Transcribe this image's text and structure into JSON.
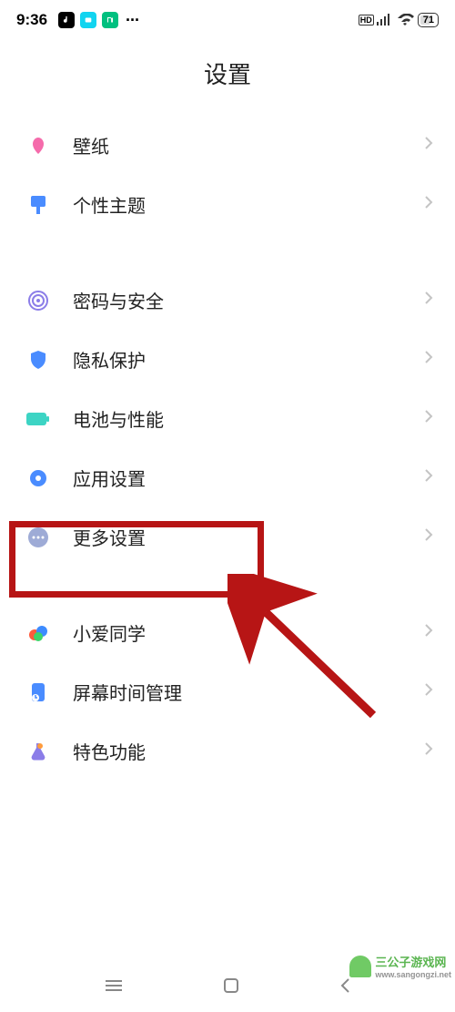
{
  "status": {
    "time": "9:36",
    "hd_label": "HD",
    "battery_percent": "71"
  },
  "page": {
    "title": "设置"
  },
  "rows": {
    "wallpaper": "壁纸",
    "theme": "个性主题",
    "password_security": "密码与安全",
    "privacy": "隐私保护",
    "battery_perf": "电池与性能",
    "app_settings": "应用设置",
    "more_settings": "更多设置",
    "xiaoai": "小爱同学",
    "screen_time": "屏幕时间管理",
    "special": "特色功能"
  },
  "watermark": {
    "text": "三公子游戏网",
    "url": "www.sangongzi.net"
  },
  "colors": {
    "highlight": "#b71515",
    "icon_blue": "#4a8cff",
    "icon_pink": "#f56bab",
    "icon_purple": "#8b7de8",
    "icon_teal": "#3dd4c4",
    "icon_orange": "#ff9c3c",
    "icon_grayblue": "#9eabd6"
  }
}
